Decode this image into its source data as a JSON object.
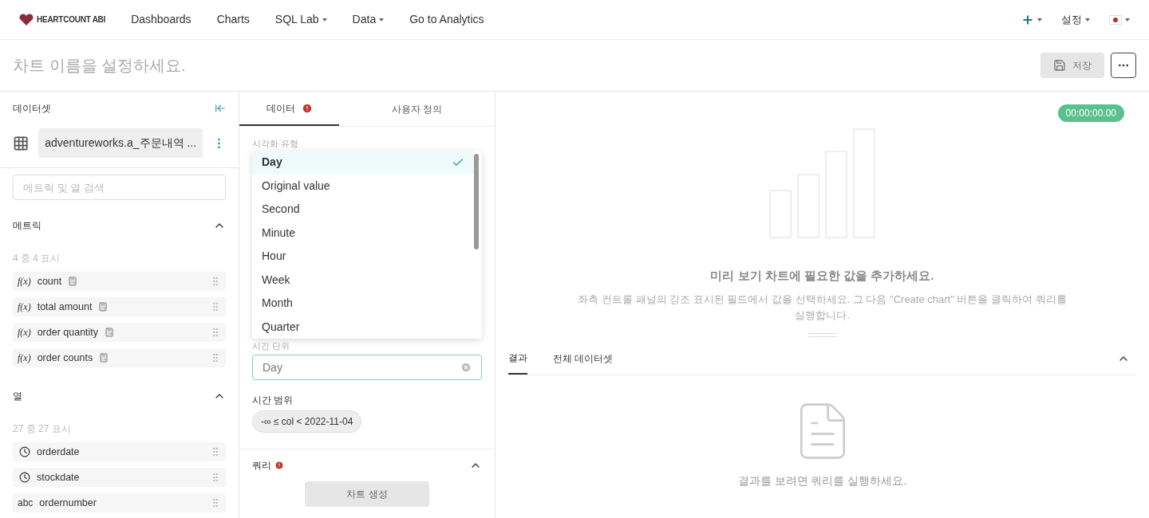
{
  "navbar": {
    "logo": "HEARTCOUNT ABI",
    "items": [
      {
        "label": "Dashboards",
        "has_menu": false
      },
      {
        "label": "Charts",
        "has_menu": false
      },
      {
        "label": "SQL Lab",
        "has_menu": true
      },
      {
        "label": "Data",
        "has_menu": true
      },
      {
        "label": "Go to Analytics",
        "has_menu": false
      }
    ],
    "settings": "설정"
  },
  "header": {
    "title_placeholder": "차트 이름을 설정하세요.",
    "save": "저장"
  },
  "dataset_panel": {
    "title": "데이터셋",
    "dataset": "adventureworks.a_주문내역 ...",
    "search_placeholder": "메트릭 및 열 검색",
    "sections": [
      {
        "title": "메트릭",
        "count": "4 중 4 표시",
        "expanded": true,
        "items": [
          {
            "kind": "metric",
            "type_label": "f(x)",
            "name": "count"
          },
          {
            "kind": "metric",
            "type_label": "f(x)",
            "name": "total amount"
          },
          {
            "kind": "metric",
            "type_label": "f(x)",
            "name": "order quantity"
          },
          {
            "kind": "metric",
            "type_label": "f(x)",
            "name": "order counts"
          }
        ]
      },
      {
        "title": "열",
        "count": "27 중 27 표시",
        "expanded": true,
        "items": [
          {
            "kind": "time",
            "name": "orderdate"
          },
          {
            "kind": "time",
            "name": "stockdate"
          },
          {
            "kind": "text",
            "type_label": "abc",
            "name": "ordernumber"
          }
        ]
      }
    ]
  },
  "control_panel": {
    "tabs": [
      {
        "label": "데이터",
        "selected": true,
        "warning": true
      },
      {
        "label": "사용자 정의",
        "selected": false,
        "warning": false
      }
    ],
    "viz_label": "시각화 유형",
    "dropdown": {
      "options": [
        {
          "label": "Day",
          "selected": true
        },
        {
          "label": "Original value",
          "selected": false
        },
        {
          "label": "Second",
          "selected": false
        },
        {
          "label": "Minute",
          "selected": false
        },
        {
          "label": "Hour",
          "selected": false
        },
        {
          "label": "Week",
          "selected": false
        },
        {
          "label": "Month",
          "selected": false
        },
        {
          "label": "Quarter",
          "selected": false
        }
      ]
    },
    "time_grain_label": "시간 단위",
    "time_grain_value": "Day",
    "time_range_label": "시간 범위",
    "time_range": "-∞ ≤ col < 2022-11-04",
    "query_label": "쿼리",
    "query_expanded": true,
    "create_button": "차트 생성"
  },
  "preview": {
    "timer": "00:00:00.00",
    "heading": "미리 보기 차트에 필요한 값을 추가하세요.",
    "description": "좌측 컨트롤 패널의 강조 표시된 필드에서 값을 선택하세요. 그 다음 \"Create chart\" 버튼을 클릭하여 쿼리를 실행합니다.",
    "result_tabs": [
      {
        "label": "결과",
        "selected": true
      },
      {
        "label": "전체 데이터셋",
        "selected": false
      }
    ],
    "results_expanded": true,
    "empty_message": "결과를 보려면 쿼리를 실행하세요."
  }
}
